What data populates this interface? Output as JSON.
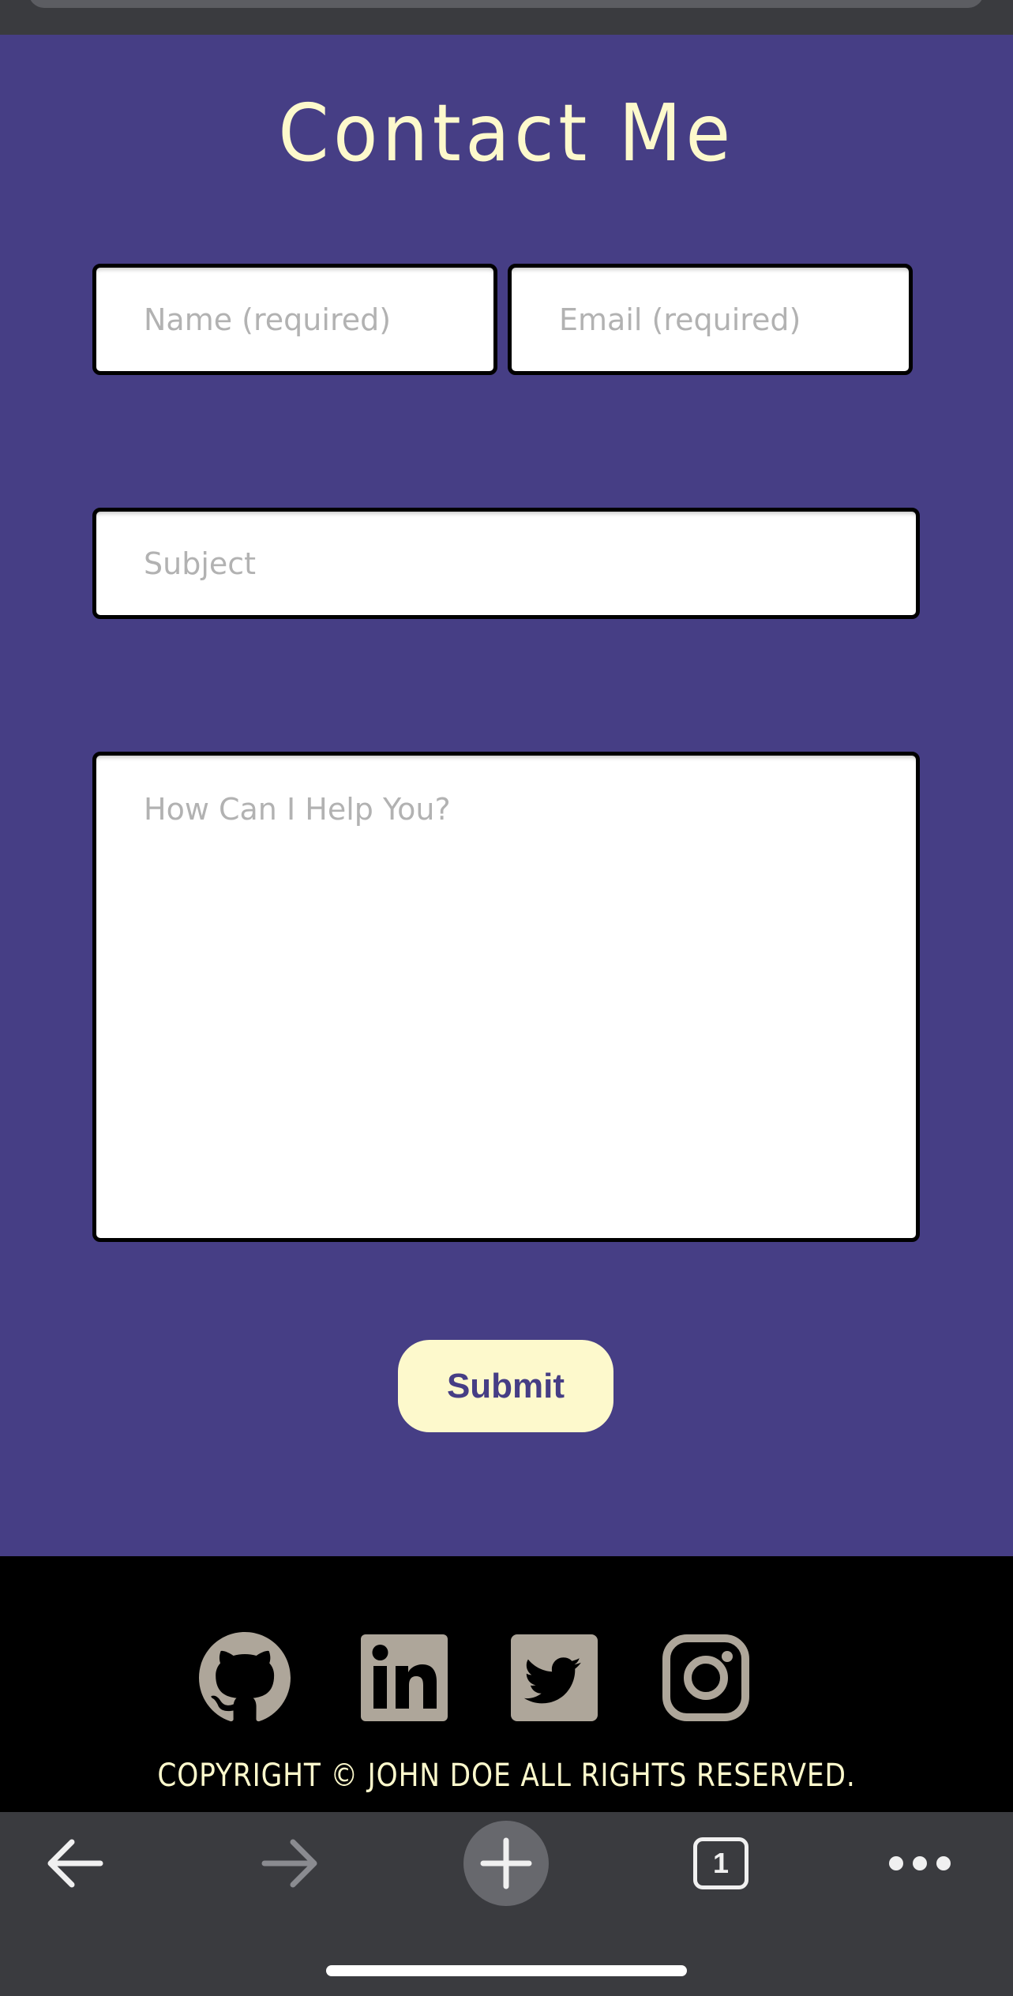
{
  "contact": {
    "title": "Contact Me",
    "name_placeholder": "Name (required)",
    "email_placeholder": "Email (required)",
    "subject_placeholder": "Subject",
    "message_placeholder": "How Can I Help You?",
    "submit_label": "Submit"
  },
  "footer": {
    "social_icons": [
      "github-icon",
      "linkedin-icon",
      "twitter-icon",
      "instagram-icon"
    ],
    "copyright": "COPYRIGHT © JOHN DOE ALL RIGHTS RESERVED."
  },
  "browser": {
    "tab_count": "1",
    "icons": [
      "back-arrow-icon",
      "forward-arrow-icon",
      "plus-icon",
      "tabs-icon",
      "more-dots-icon"
    ]
  },
  "colors": {
    "section_bg": "#463e85",
    "accent_cream": "#fdf9cc",
    "footer_bg": "#000000",
    "icon_gray": "#aea69a",
    "browser_chrome": "#3a3b3f"
  }
}
